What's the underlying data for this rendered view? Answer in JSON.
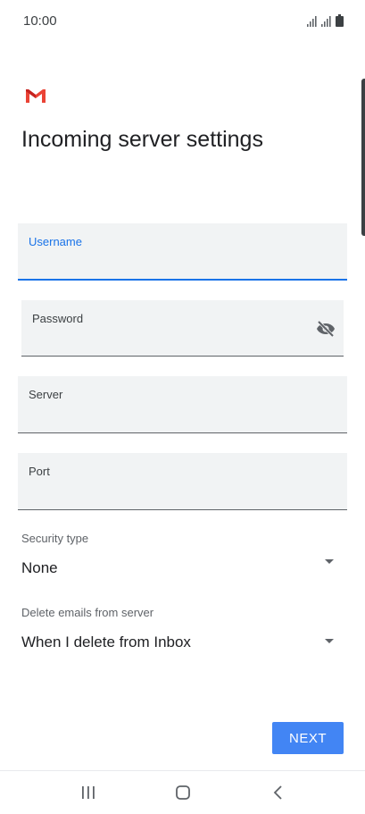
{
  "status_bar": {
    "time": "10:00",
    "icons": [
      "signal-icon",
      "signal-icon",
      "battery-icon"
    ]
  },
  "app": {
    "logo": "gmail-logo",
    "brand_color": "#EA4335"
  },
  "page": {
    "title": "Incoming server settings"
  },
  "form": {
    "username": {
      "label": "Username",
      "value": "",
      "focused": true
    },
    "password": {
      "label": "Password",
      "value": "",
      "toggle_icon": "eye-off-icon"
    },
    "server": {
      "label": "Server",
      "value": ""
    },
    "port": {
      "label": "Port",
      "value": ""
    },
    "security_type": {
      "label": "Security type",
      "value": "None"
    },
    "delete_emails": {
      "label": "Delete emails from server",
      "value": "When I delete from Inbox"
    }
  },
  "actions": {
    "next_label": "NEXT"
  },
  "nav_bar": {
    "recents_icon": "recents-icon",
    "home_icon": "home-icon",
    "back_icon": "back-icon"
  },
  "colors": {
    "accent": "#1A73E8",
    "button": "#4285F4",
    "field_bg": "#F1F3F4"
  }
}
